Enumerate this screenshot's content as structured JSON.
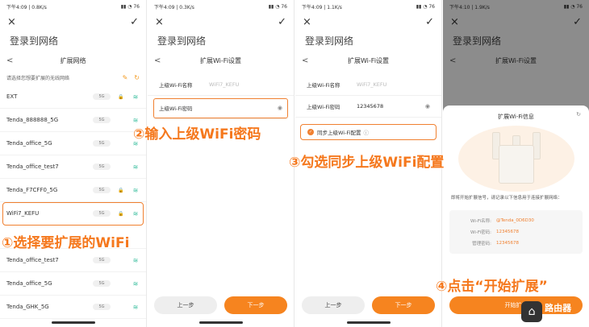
{
  "colors": {
    "accent": "#f6841f",
    "callout": "#f5781d",
    "wifi": "#3bbf9f"
  },
  "win": {
    "title": "登录到网络",
    "close_icon": "×",
    "check_icon": "✓"
  },
  "panel1": {
    "status_time": "下午4:09 | 0.8K/s",
    "status_right": "▮▮ ◔ 76",
    "nav_title": "扩展网络",
    "hint": "请选择您想要扩展的无线网络",
    "networks": [
      {
        "name": "EXT",
        "band": "5G",
        "lock": true
      },
      {
        "name": "Tenda_888888_5G",
        "band": "5G",
        "lock": false
      },
      {
        "name": "Tenda_office_5G",
        "band": "5G",
        "lock": false
      },
      {
        "name": "Tenda_office_test7",
        "band": "5G",
        "lock": false
      },
      {
        "name": "Tenda_F7CFF0_5G",
        "band": "5G",
        "lock": true
      },
      {
        "name": "WiFi7_KEFU",
        "band": "5G",
        "lock": true
      },
      {
        "name": "",
        "band": "",
        "lock": false
      },
      {
        "name": "Tenda_office_test7",
        "band": "5G",
        "lock": false
      },
      {
        "name": "Tenda_office_5G",
        "band": "5G",
        "lock": false
      },
      {
        "name": "Tenda_GHK_5G",
        "band": "5G",
        "lock": false
      }
    ]
  },
  "panel2": {
    "status_time": "下午4:09 | 0.3K/s",
    "status_right": "▮▮ ◔ 76",
    "nav_title": "扩展Wi-Fi设置",
    "ssid_label": "上级Wi-Fi名称",
    "ssid_value": "WiFi7_KEFU",
    "pwd_label": "上级Wi-Fi密码",
    "prev": "上一步",
    "next": "下一步"
  },
  "panel3": {
    "status_time": "下午4:09 | 1.1K/s",
    "status_right": "▮▮ ◔ 76",
    "nav_title": "扩展Wi-Fi设置",
    "ssid_label": "上级Wi-Fi名称",
    "ssid_value": "WiFi7_KEFU",
    "pwd_label": "上级Wi-Fi密码",
    "pwd_value": "12345678",
    "sync_label": "同步上级Wi-Fi配置",
    "prev": "上一步",
    "next": "下一步"
  },
  "panel4": {
    "status_time": "下午4:10 | 1.9K/s",
    "status_right": "▮▮ ◔ 76",
    "nav_title": "扩展Wi-Fi设置",
    "sheet_title": "扩展Wi-Fi信息",
    "desc": "即将开始扩展信号，请记录以下信息用于连接扩展网络：",
    "info": [
      {
        "k": "Wi-Fi名称:",
        "v": "@Tenda_0D6D30"
      },
      {
        "k": "Wi-Fi密码:",
        "v": "12345678"
      },
      {
        "k": "管理密码:",
        "v": "12345678"
      }
    ],
    "start_btn": "开始扩展"
  },
  "callouts": {
    "c1": "①选择要扩展的WiFi",
    "c2": "②输入上级WiFi密码",
    "c3": "③勾选同步上级WiFi配置",
    "c4": "④点击“开始扩展”"
  },
  "watermark": {
    "line1": "路由器",
    "line2": "luyouqi.com"
  }
}
